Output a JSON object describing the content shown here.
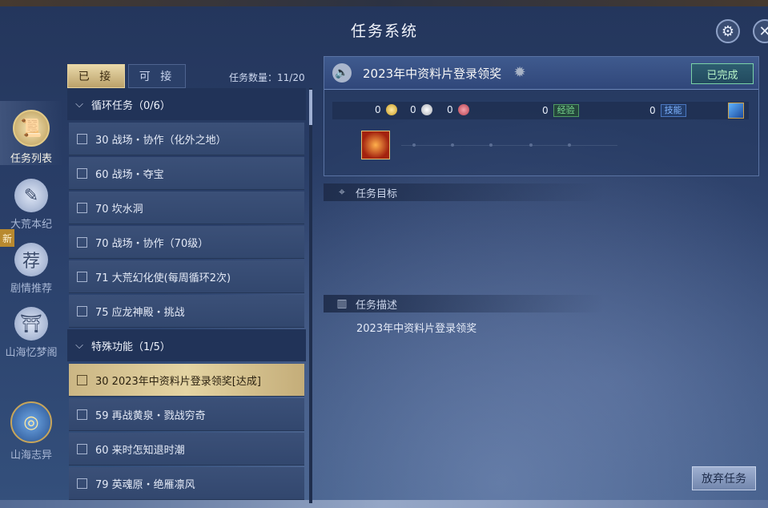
{
  "header": {
    "title": "任务系统"
  },
  "nav": {
    "items": [
      {
        "label": "任务列表"
      },
      {
        "label": "大荒本纪"
      },
      {
        "label": "剧情推荐",
        "badge": "新",
        "icon_char": "荐"
      },
      {
        "label": "山海忆梦阁"
      },
      {
        "label": "山海志异"
      }
    ]
  },
  "tabs": {
    "accepted": "已 接",
    "available": "可 接"
  },
  "quest_count": "任务数量：11/20",
  "categories": [
    {
      "label": "循环任务（0/6）"
    },
    {
      "label": "特殊功能（1/5）"
    }
  ],
  "quests": [
    "30 战场・协作（化外之地）",
    "60 战场・夺宝",
    "70 坎水洞",
    "70 战场・协作（70级）",
    "71 大荒幻化使(每周循环2次)",
    "75 应龙神殿・挑战",
    "30 2023年中资料片登录领奖[达成]",
    "59 再战黄泉・戮战穷奇",
    "60 来时怎知退时潮",
    "79 英魂原・绝雁凛风"
  ],
  "detail": {
    "quest_name": "2023年中资料片登录领奖",
    "status": "已完成",
    "rewards": {
      "gold": "0",
      "silver": "0",
      "red": "0",
      "exp_value": "0",
      "exp_label": "经验",
      "skill_value": "0",
      "skill_label": "技能"
    },
    "objective_label": "任务目标",
    "description_label": "任务描述",
    "description": "2023年中资料片登录领奖"
  },
  "abandon_label": "放弃任务",
  "colors": {
    "accent_gold": "#e4d4a3",
    "panel_blue": "#30477a",
    "done_green": "#b7f4c8"
  }
}
